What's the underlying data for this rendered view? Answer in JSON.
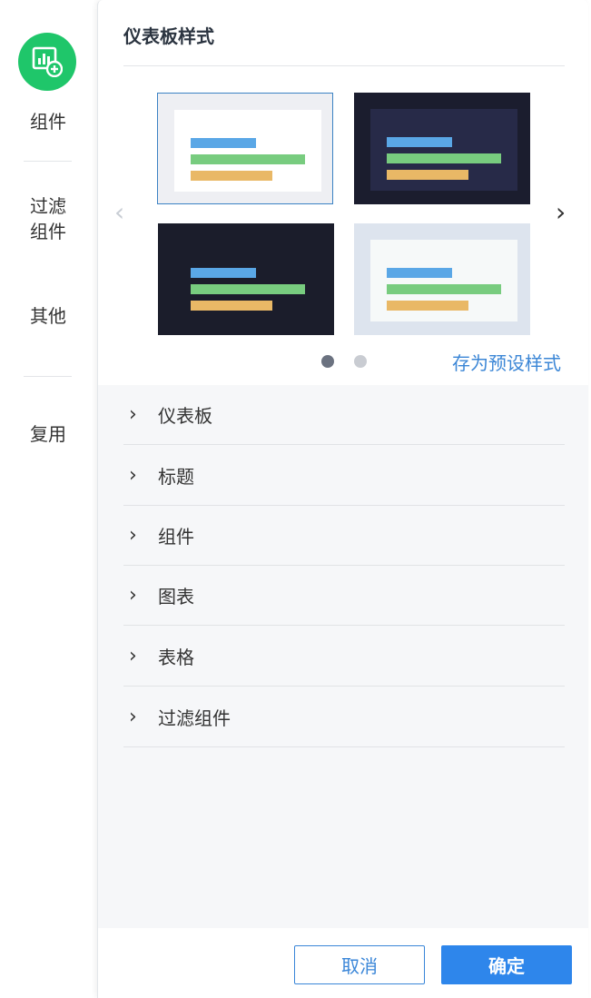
{
  "rail": {
    "items": [
      {
        "label": "组件"
      },
      {
        "label": "过滤\n组件"
      },
      {
        "label": "其他"
      },
      {
        "label": "复用"
      }
    ]
  },
  "panel": {
    "title": "仪表板样式",
    "save_preset_label": "存为预设样式",
    "carousel": {
      "page": 1,
      "pages": 2
    },
    "sections": [
      {
        "label": "仪表板"
      },
      {
        "label": "标题"
      },
      {
        "label": "组件"
      },
      {
        "label": "图表"
      },
      {
        "label": "表格"
      },
      {
        "label": "过滤组件"
      }
    ]
  },
  "footer": {
    "cancel_label": "取消",
    "ok_label": "确定"
  },
  "colors": {
    "accent": "#2e86eb",
    "rail_logo": "#1fc66a",
    "bar_blue": "#5aa7e6",
    "bar_green": "#78cc7f",
    "bar_orange": "#e9b866"
  },
  "icons": {
    "rail_logo": "chart-add-icon",
    "prev": "chevron-left-icon",
    "next": "chevron-right-icon",
    "section": "chevron-right-icon"
  }
}
